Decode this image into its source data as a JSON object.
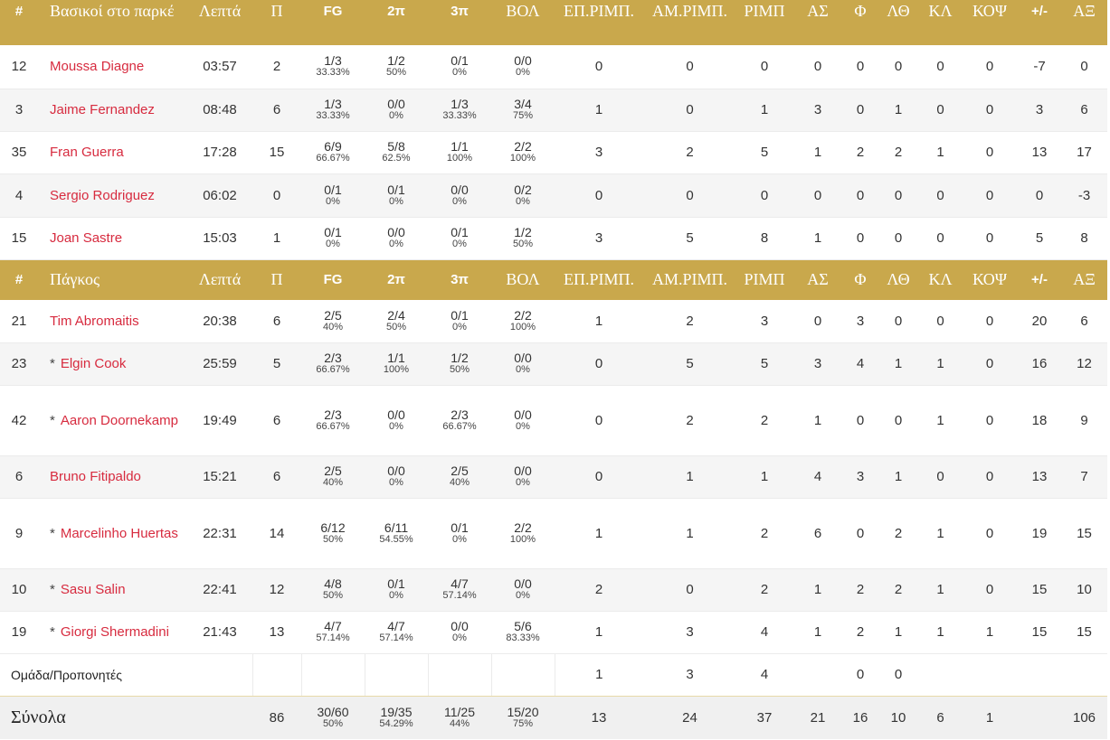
{
  "columns": {
    "num": "#",
    "min": "Λεπτά",
    "pts": "Π",
    "fg": "FG",
    "p2": "2π",
    "p3": "3π",
    "ft": "ΒΟΛ",
    "oreb": "ΕΠ.ΡΙΜΠ.",
    "dreb": "ΑΜ.ΡΙΜΠ.",
    "reb": "ΡΙΜΠ",
    "ast": "ΑΣ",
    "pf": "Φ",
    "to": "ΛΘ",
    "stl": "ΚΛ",
    "blk": "ΚΟΨ",
    "pm": "+/-",
    "eff": "ΑΞ"
  },
  "starters_label": "Βασικοί στο παρκέ",
  "bench_label": "Πάγκος",
  "starters": [
    {
      "num": "12",
      "star": "",
      "name": "Moussa Diagne",
      "min": "03:57",
      "pts": "2",
      "fg": "1/3",
      "fg_pct": "33.33%",
      "p2": "1/2",
      "p2_pct": "50%",
      "p3": "0/1",
      "p3_pct": "0%",
      "ft": "0/0",
      "ft_pct": "0%",
      "oreb": "0",
      "dreb": "0",
      "reb": "0",
      "ast": "0",
      "pf": "0",
      "to": "0",
      "stl": "0",
      "blk": "0",
      "pm": "-7",
      "eff": "0"
    },
    {
      "num": "3",
      "star": "",
      "name": "Jaime Fernandez",
      "min": "08:48",
      "pts": "6",
      "fg": "1/3",
      "fg_pct": "33.33%",
      "p2": "0/0",
      "p2_pct": "0%",
      "p3": "1/3",
      "p3_pct": "33.33%",
      "ft": "3/4",
      "ft_pct": "75%",
      "oreb": "1",
      "dreb": "0",
      "reb": "1",
      "ast": "3",
      "pf": "0",
      "to": "1",
      "stl": "0",
      "blk": "0",
      "pm": "3",
      "eff": "6"
    },
    {
      "num": "35",
      "star": "",
      "name": "Fran Guerra",
      "min": "17:28",
      "pts": "15",
      "fg": "6/9",
      "fg_pct": "66.67%",
      "p2": "5/8",
      "p2_pct": "62.5%",
      "p3": "1/1",
      "p3_pct": "100%",
      "ft": "2/2",
      "ft_pct": "100%",
      "oreb": "3",
      "dreb": "2",
      "reb": "5",
      "ast": "1",
      "pf": "2",
      "to": "2",
      "stl": "1",
      "blk": "0",
      "pm": "13",
      "eff": "17"
    },
    {
      "num": "4",
      "star": "",
      "name": "Sergio Rodriguez",
      "min": "06:02",
      "pts": "0",
      "fg": "0/1",
      "fg_pct": "0%",
      "p2": "0/1",
      "p2_pct": "0%",
      "p3": "0/0",
      "p3_pct": "0%",
      "ft": "0/2",
      "ft_pct": "0%",
      "oreb": "0",
      "dreb": "0",
      "reb": "0",
      "ast": "0",
      "pf": "0",
      "to": "0",
      "stl": "0",
      "blk": "0",
      "pm": "0",
      "eff": "-3"
    },
    {
      "num": "15",
      "star": "",
      "name": "Joan Sastre",
      "min": "15:03",
      "pts": "1",
      "fg": "0/1",
      "fg_pct": "0%",
      "p2": "0/0",
      "p2_pct": "0%",
      "p3": "0/1",
      "p3_pct": "0%",
      "ft": "1/2",
      "ft_pct": "50%",
      "oreb": "3",
      "dreb": "5",
      "reb": "8",
      "ast": "1",
      "pf": "0",
      "to": "0",
      "stl": "0",
      "blk": "0",
      "pm": "5",
      "eff": "8"
    }
  ],
  "bench": [
    {
      "num": "21",
      "star": "",
      "name": "Tim Abromaitis",
      "min": "20:38",
      "pts": "6",
      "fg": "2/5",
      "fg_pct": "40%",
      "p2": "2/4",
      "p2_pct": "50%",
      "p3": "0/1",
      "p3_pct": "0%",
      "ft": "2/2",
      "ft_pct": "100%",
      "oreb": "1",
      "dreb": "2",
      "reb": "3",
      "ast": "0",
      "pf": "3",
      "to": "0",
      "stl": "0",
      "blk": "0",
      "pm": "20",
      "eff": "6"
    },
    {
      "num": "23",
      "star": "*",
      "name": "Elgin Cook",
      "min": "25:59",
      "pts": "5",
      "fg": "2/3",
      "fg_pct": "66.67%",
      "p2": "1/1",
      "p2_pct": "100%",
      "p3": "1/2",
      "p3_pct": "50%",
      "ft": "0/0",
      "ft_pct": "0%",
      "oreb": "0",
      "dreb": "5",
      "reb": "5",
      "ast": "3",
      "pf": "4",
      "to": "1",
      "stl": "1",
      "blk": "0",
      "pm": "16",
      "eff": "12"
    },
    {
      "num": "42",
      "star": "*",
      "name": "Aaron Doornekamp",
      "min": "19:49",
      "pts": "6",
      "fg": "2/3",
      "fg_pct": "66.67%",
      "p2": "0/0",
      "p2_pct": "0%",
      "p3": "2/3",
      "p3_pct": "66.67%",
      "ft": "0/0",
      "ft_pct": "0%",
      "oreb": "0",
      "dreb": "2",
      "reb": "2",
      "ast": "1",
      "pf": "0",
      "to": "0",
      "stl": "1",
      "blk": "0",
      "pm": "18",
      "eff": "9"
    },
    {
      "num": "6",
      "star": "",
      "name": "Bruno Fitipaldo",
      "min": "15:21",
      "pts": "6",
      "fg": "2/5",
      "fg_pct": "40%",
      "p2": "0/0",
      "p2_pct": "0%",
      "p3": "2/5",
      "p3_pct": "40%",
      "ft": "0/0",
      "ft_pct": "0%",
      "oreb": "0",
      "dreb": "1",
      "reb": "1",
      "ast": "4",
      "pf": "3",
      "to": "1",
      "stl": "0",
      "blk": "0",
      "pm": "13",
      "eff": "7"
    },
    {
      "num": "9",
      "star": "*",
      "name": "Marcelinho Huertas",
      "min": "22:31",
      "pts": "14",
      "fg": "6/12",
      "fg_pct": "50%",
      "p2": "6/11",
      "p2_pct": "54.55%",
      "p3": "0/1",
      "p3_pct": "0%",
      "ft": "2/2",
      "ft_pct": "100%",
      "oreb": "1",
      "dreb": "1",
      "reb": "2",
      "ast": "6",
      "pf": "0",
      "to": "2",
      "stl": "1",
      "blk": "0",
      "pm": "19",
      "eff": "15"
    },
    {
      "num": "10",
      "star": "*",
      "name": "Sasu Salin",
      "min": "22:41",
      "pts": "12",
      "fg": "4/8",
      "fg_pct": "50%",
      "p2": "0/1",
      "p2_pct": "0%",
      "p3": "4/7",
      "p3_pct": "57.14%",
      "ft": "0/0",
      "ft_pct": "0%",
      "oreb": "2",
      "dreb": "0",
      "reb": "2",
      "ast": "1",
      "pf": "2",
      "to": "2",
      "stl": "1",
      "blk": "0",
      "pm": "15",
      "eff": "10"
    },
    {
      "num": "19",
      "star": "*",
      "name": "Giorgi Shermadini",
      "min": "21:43",
      "pts": "13",
      "fg": "4/7",
      "fg_pct": "57.14%",
      "p2": "4/7",
      "p2_pct": "57.14%",
      "p3": "0/0",
      "p3_pct": "0%",
      "ft": "5/6",
      "ft_pct": "83.33%",
      "oreb": "1",
      "dreb": "3",
      "reb": "4",
      "ast": "1",
      "pf": "2",
      "to": "1",
      "stl": "1",
      "blk": "1",
      "pm": "15",
      "eff": "15"
    }
  ],
  "team": {
    "label": "Ομάδα/Προπονητές",
    "oreb": "1",
    "dreb": "3",
    "reb": "4",
    "pf": "0",
    "to": "0"
  },
  "totals": {
    "label": "Σύνολα",
    "pts": "86",
    "fg": "30/60",
    "fg_pct": "50%",
    "p2": "19/35",
    "p2_pct": "54.29%",
    "p3": "11/25",
    "p3_pct": "44%",
    "ft": "15/20",
    "ft_pct": "75%",
    "oreb": "13",
    "dreb": "24",
    "reb": "37",
    "ast": "21",
    "pf": "16",
    "to": "10",
    "stl": "6",
    "blk": "1",
    "eff": "106"
  }
}
